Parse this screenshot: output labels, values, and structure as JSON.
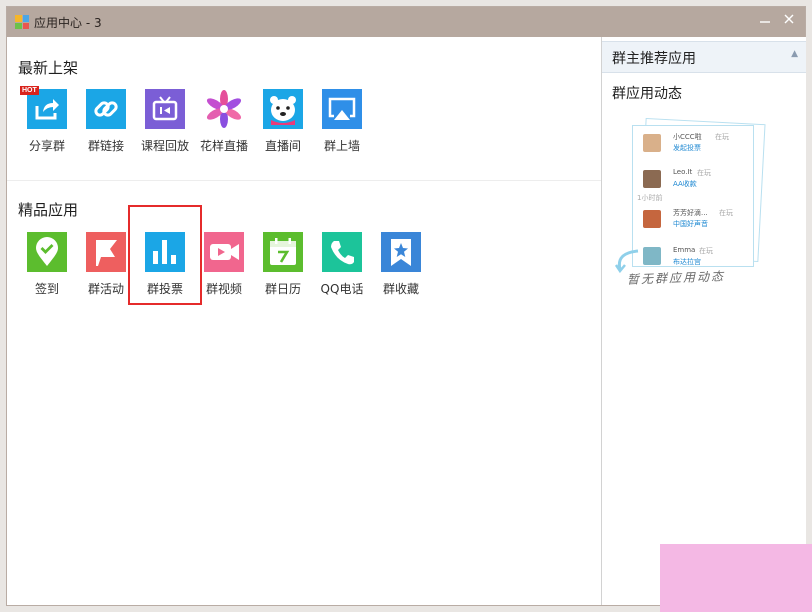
{
  "window": {
    "title": "应用中心 - 3"
  },
  "sections": {
    "new": {
      "title": "最新上架",
      "badge": "HOT",
      "apps": [
        {
          "label": "分享群",
          "icon": "share-icon",
          "color": "#1ba6e6"
        },
        {
          "label": "群链接",
          "icon": "link-icon",
          "color": "#1ba6e6"
        },
        {
          "label": "课程回放",
          "icon": "tv-replay-icon",
          "color": "#7b5ed6"
        },
        {
          "label": "花样直播",
          "icon": "flower-live-icon",
          "color": "#a45ae0"
        },
        {
          "label": "直播间",
          "icon": "bear-icon",
          "color": "#1ba6e6"
        },
        {
          "label": "群上墙",
          "icon": "screen-cast-icon",
          "color": "#2f8fe8"
        }
      ]
    },
    "featured": {
      "title": "精品应用",
      "apps": [
        {
          "label": "签到",
          "icon": "location-check-icon",
          "color": "#5cbd2e"
        },
        {
          "label": "群活动",
          "icon": "flag-icon",
          "color": "#ee5f5f"
        },
        {
          "label": "群投票",
          "icon": "bar-chart-icon",
          "color": "#1ba6e6"
        },
        {
          "label": "群视频",
          "icon": "video-camera-icon",
          "color": "#f1668e"
        },
        {
          "label": "群日历",
          "icon": "calendar-icon",
          "color": "#5cbd2e"
        },
        {
          "label": "QQ电话",
          "icon": "phone-icon",
          "color": "#1cc49a"
        },
        {
          "label": "群收藏",
          "icon": "bookmark-star-icon",
          "color": "#3a86d8"
        }
      ]
    }
  },
  "sidebar": {
    "header": "群主推荐应用",
    "dynamics_title": "群应用动态",
    "empty_text": "暂无群应用动态",
    "cards": [
      {
        "name": "小CCC啦",
        "status": "在玩",
        "action": "发起投票"
      },
      {
        "name": "Leo.It",
        "status": "在玩",
        "action": "AA收款"
      },
      {
        "time": "1小时前"
      },
      {
        "name": "芳芳好滴...",
        "status": "在玩",
        "action": "中国好声音"
      },
      {
        "name": "Emma",
        "status": "在玩",
        "action": "布达拉宫"
      }
    ]
  }
}
